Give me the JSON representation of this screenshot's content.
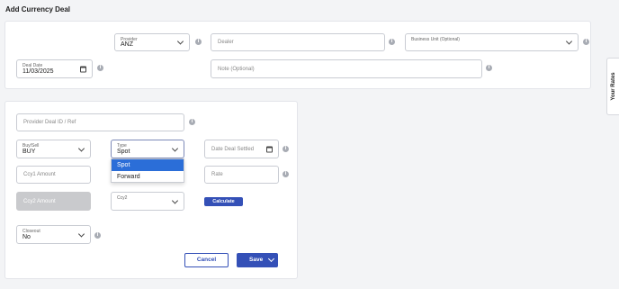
{
  "page": {
    "title": "Add Currency Deal"
  },
  "side_tab": {
    "label": "Your Rates"
  },
  "top_card": {
    "provider": {
      "label": "Provider",
      "value": "ANZ"
    },
    "dealer": {
      "placeholder": "Dealer"
    },
    "business_unit": {
      "label": "Business Unit (Optional)"
    },
    "deal_date": {
      "label": "Deal Date",
      "value": "11/03/2025"
    },
    "note": {
      "placeholder": "Note (Optional)"
    }
  },
  "bottom_card": {
    "provider_deal_id": {
      "placeholder": "Provider Deal ID / Ref"
    },
    "buy_sell": {
      "label": "Buy/Sell",
      "value": "BUY"
    },
    "type": {
      "label": "Type",
      "value": "Spot",
      "options": [
        {
          "label": "Spot",
          "selected": true
        },
        {
          "label": "Forward",
          "selected": false
        }
      ]
    },
    "date_deal_settled": {
      "placeholder": "Date Deal Settled"
    },
    "ccy1_amount": {
      "placeholder": "Ccy1 Amount"
    },
    "rate": {
      "placeholder": "Rate"
    },
    "ccy2_amount": {
      "placeholder": "Ccy2 Amount"
    },
    "ccy2": {
      "label": "Ccy2"
    },
    "calculate": {
      "label": "Calculate"
    },
    "closeout": {
      "label": "Closeout",
      "value": "No"
    },
    "cancel": {
      "label": "Cancel"
    },
    "save": {
      "label": "Save"
    }
  },
  "icons": {
    "info": "i"
  },
  "colors": {
    "primary": "#3450b7",
    "dropdown_highlight": "#2b6ed8",
    "disabled_field": "#c9cacd"
  }
}
